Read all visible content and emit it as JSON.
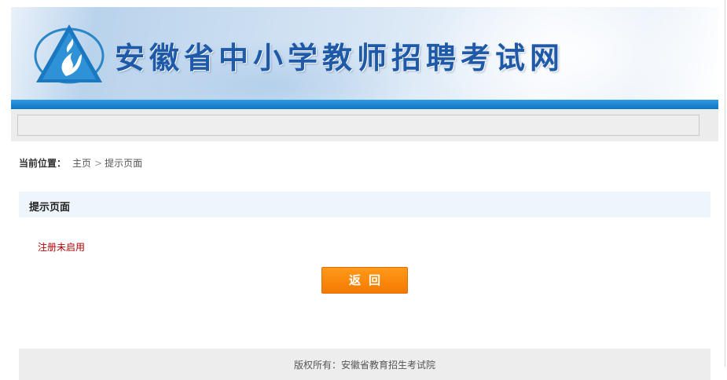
{
  "header": {
    "site_title": "安徽省中小学教师招聘考试网",
    "logo_icon": "flame-triangle-logo-icon"
  },
  "breadcrumb": {
    "label": "当前位置：",
    "home": "主页",
    "separator": ">",
    "current": "提示页面"
  },
  "panel": {
    "title": "提示页面",
    "message": "注册未启用"
  },
  "buttons": {
    "back_label": "返回"
  },
  "footer": {
    "copyright": "版权所有：安徽省教育招生考试院"
  },
  "colors": {
    "accent_blue": "#0c74c4",
    "button_orange": "#f47a00",
    "message_red": "#b30000",
    "panel_bg": "#eef6fc"
  }
}
